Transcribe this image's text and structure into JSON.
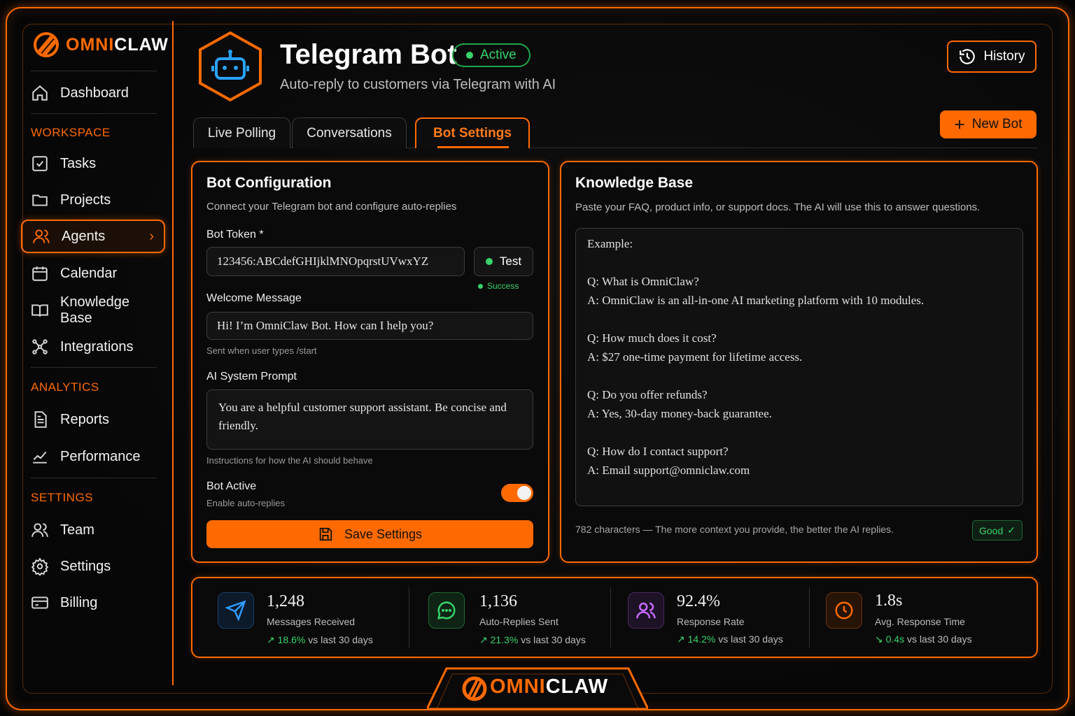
{
  "brand": {
    "name_primary": "OMNI",
    "name_secondary": "CLAW"
  },
  "colors": {
    "accent": "#ff6a00",
    "success": "#38d36a"
  },
  "sidebar": {
    "top": [
      {
        "label": "Dashboard",
        "icon": "home-icon"
      }
    ],
    "sections": [
      {
        "title": "WORKSPACE",
        "items": [
          "Tasks",
          "Projects",
          "Agents",
          "Calendar",
          "Knowledge Base",
          "Integrations"
        ]
      },
      {
        "title": "ANALYTICS",
        "items": [
          "Reports",
          "Performance"
        ]
      },
      {
        "title": "SETTINGS",
        "items": [
          "Team",
          "Settings",
          "Billing"
        ]
      }
    ],
    "active_item": "Agents"
  },
  "header": {
    "title": "Telegram Bot",
    "status": "Active",
    "subtitle": "Auto-reply to customers via Telegram with AI",
    "history_label": "History",
    "new_bot_label": "New Bot"
  },
  "tabs": [
    {
      "label": "Live Polling",
      "active": false
    },
    {
      "label": "Conversations",
      "active": false
    },
    {
      "label": "Bot Settings",
      "active": true
    }
  ],
  "config": {
    "title": "Bot Configuration",
    "subtitle": "Connect your Telegram bot and configure auto-replies",
    "token_label": "Bot Token *",
    "token_value": "123456:ABCdefGHIjklMNOpqrstUVwxYZ",
    "test_label": "Test",
    "test_status": "Success",
    "welcome_label": "Welcome Message",
    "welcome_value": "Hi! I’m OmniClaw Bot. How can I help you?",
    "welcome_hint": "Sent when user types /start",
    "prompt_label": "AI System Prompt",
    "prompt_value": "You are a helpful customer support assistant. Be concise and friendly.",
    "prompt_hint": "Instructions for how the AI should behave",
    "active_label": "Bot Active",
    "active_hint": "Enable auto-replies",
    "active_on": true,
    "save_label": "Save Settings"
  },
  "knowledge": {
    "title": "Knowledge Base",
    "subtitle": "Paste your FAQ, product info, or support docs. The AI will use this to answer questions.",
    "lines": [
      "Example:",
      "",
      "Q: What is OmniClaw?",
      "A: OmniClaw is an all-in-one AI marketing platform with 10 modules.",
      "",
      "Q: How much does it cost?",
      "A: $27 one-time payment for lifetime access.",
      "",
      "Q: Do you offer refunds?",
      "A: Yes, 30-day money-back guarantee.",
      "",
      "Q: How do I contact support?",
      "A: Email support@omniclaw.com"
    ],
    "footer": "782 characters — The more context you provide, the better the AI replies.",
    "quality": "Good"
  },
  "stats": [
    {
      "value": "1,248",
      "label": "Messages Received",
      "change": "18.6%",
      "suffix": "vs last 30 days",
      "icon": "send-icon",
      "trend": "up"
    },
    {
      "value": "1,136",
      "label": "Auto-Replies Sent",
      "change": "21.3%",
      "suffix": "vs last 30 days",
      "icon": "chat-icon",
      "trend": "up"
    },
    {
      "value": "92.4%",
      "label": "Response Rate",
      "change": "14.2%",
      "suffix": "vs last 30 days",
      "icon": "users-icon",
      "trend": "up"
    },
    {
      "value": "1.8s",
      "label": "Avg. Response Time",
      "change": "0.4s",
      "suffix": "vs last 30 days",
      "icon": "clock-icon",
      "trend": "down"
    }
  ]
}
